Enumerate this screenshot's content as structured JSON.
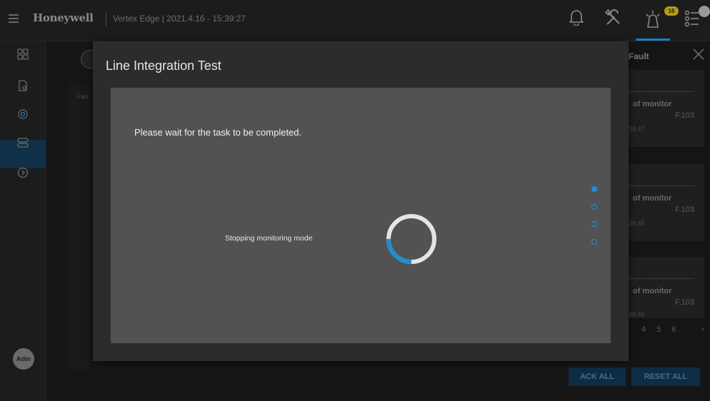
{
  "header": {
    "brand": "Honeywell",
    "device_info": "Vertex Edge | 2021.4.16 - 15:39:27",
    "alarm_count": "16"
  },
  "sidebar": {
    "avatar": "Adm"
  },
  "background": {
    "table_header": "Fau"
  },
  "fault_panel": {
    "title": "Fault",
    "cards": [
      {
        "title": "of monitor",
        "code": "F.103",
        "time": "38:47"
      },
      {
        "title": "of monitor",
        "code": "F.103",
        "time": "38:45"
      },
      {
        "title": "of monitor",
        "code": "F.103",
        "time": "38:45"
      }
    ],
    "pagination": [
      "4",
      "5",
      "6"
    ],
    "ack_all_label": "ACK ALL",
    "reset_all_label": "RESET ALL"
  },
  "modal": {
    "title": "Line Integration Test",
    "wait_message": "Please wait for the task to be completed.",
    "status_message": "Stopping monitoring mode",
    "steps": [
      "done",
      "pending",
      "pending",
      "pending"
    ],
    "spinner_progress_fraction": 0.25
  },
  "colors": {
    "accent": "#1d8fd6",
    "modal_bg": "#2c2c2c",
    "modal_body_bg": "#525252",
    "alarm_badge": "#b89a14"
  }
}
